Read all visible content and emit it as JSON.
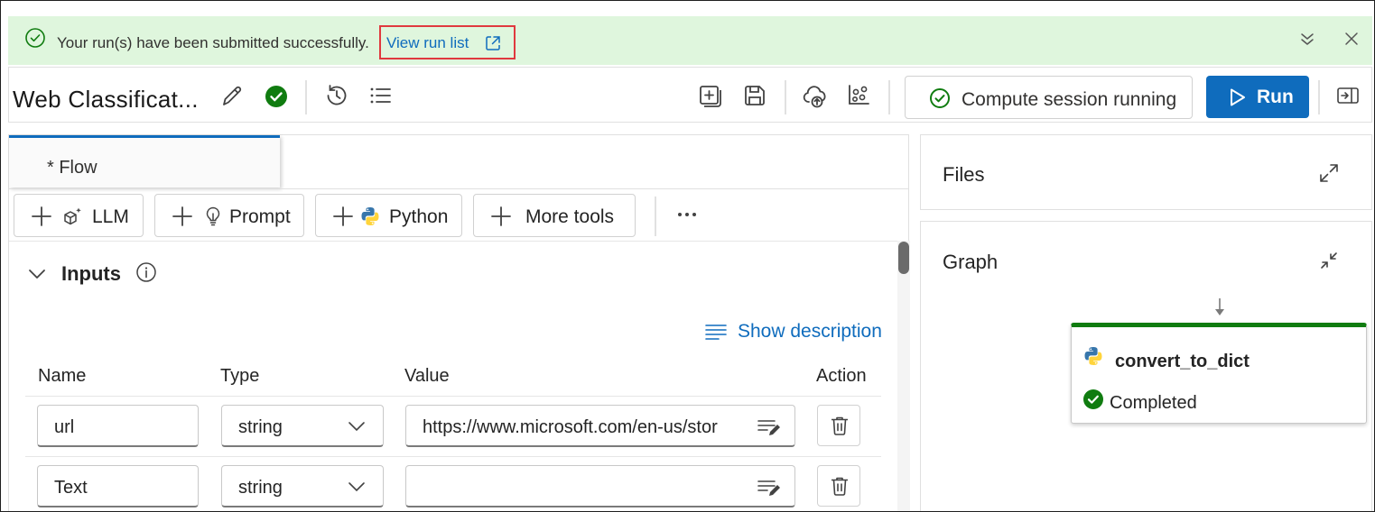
{
  "banner": {
    "message": "Your run(s) have been submitted successfully.",
    "link_label": "View run list",
    "icons": [
      "success-check-icon",
      "external-link-icon",
      "collapse-icon",
      "close-icon"
    ]
  },
  "toolbar": {
    "title": "Web Classificat...",
    "compute_label": "Compute session running",
    "run_label": "Run",
    "icons": [
      "edit-icon",
      "status-check-icon",
      "history-icon",
      "list-icon",
      "clone-icon",
      "save-icon",
      "deploy-icon",
      "evaluate-icon",
      "panel-toggle-icon"
    ]
  },
  "flow": {
    "tab_label": "* Flow",
    "tools": [
      {
        "label": "LLM",
        "icon": "llm-icon"
      },
      {
        "label": "Prompt",
        "icon": "prompt-bulb-icon"
      },
      {
        "label": "Python",
        "icon": "python-icon"
      },
      {
        "label": "More tools",
        "icon": ""
      }
    ]
  },
  "inputs": {
    "title": "Inputs",
    "show_description": "Show description",
    "headers": {
      "name": "Name",
      "type": "Type",
      "value": "Value",
      "action": "Action"
    },
    "rows": [
      {
        "name": "url",
        "type": "string",
        "value": "https://www.microsoft.com/en-us/stor"
      },
      {
        "name": "Text",
        "type": "string",
        "value": ""
      }
    ]
  },
  "files": {
    "title": "Files"
  },
  "graph": {
    "title": "Graph",
    "node": {
      "name": "convert_to_dict",
      "status": "Completed"
    }
  },
  "colors": {
    "accent": "#0f6cbd",
    "success": "#107c10",
    "banner_bg": "#dff6dd",
    "highlight": "#e0393e"
  }
}
